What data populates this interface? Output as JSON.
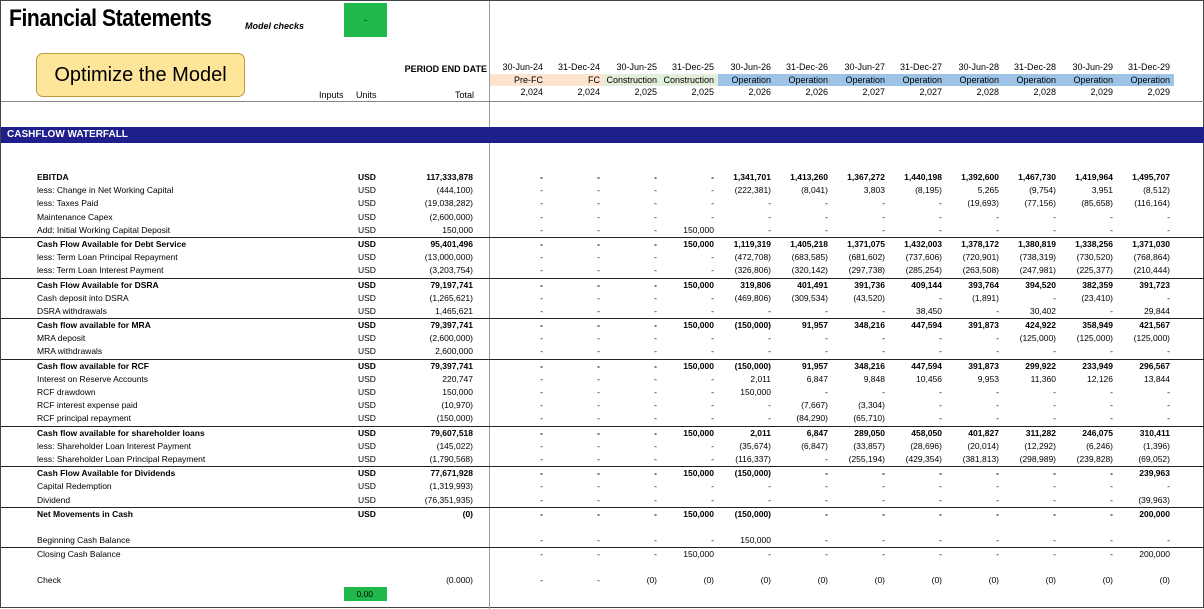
{
  "header": {
    "title": "Financial Statements",
    "model_checks_label": "Model checks",
    "model_checks_value": "-",
    "optimize_button": "Optimize the Model",
    "period_end_label": "PERIOD END DATE",
    "inputs_label": "Inputs",
    "units_label": "Units",
    "total_label": "Total"
  },
  "periods": [
    {
      "date": "30-Jun-24",
      "phase": "Pre-FC",
      "year": "2,024",
      "color": "#fde4cf"
    },
    {
      "date": "31-Dec-24",
      "phase": "FC",
      "year": "2,024",
      "color": "#fde4cf"
    },
    {
      "date": "30-Jun-25",
      "phase": "Construction",
      "year": "2,025",
      "color": "#e2efda"
    },
    {
      "date": "31-Dec-25",
      "phase": "Construction",
      "year": "2,025",
      "color": "#e2efda"
    },
    {
      "date": "30-Jun-26",
      "phase": "Operation",
      "year": "2,026",
      "color": "#9dc3e6"
    },
    {
      "date": "31-Dec-26",
      "phase": "Operation",
      "year": "2,026",
      "color": "#9dc3e6"
    },
    {
      "date": "30-Jun-27",
      "phase": "Operation",
      "year": "2,027",
      "color": "#9dc3e6"
    },
    {
      "date": "31-Dec-27",
      "phase": "Operation",
      "year": "2,027",
      "color": "#9dc3e6"
    },
    {
      "date": "30-Jun-28",
      "phase": "Operation",
      "year": "2,028",
      "color": "#9dc3e6"
    },
    {
      "date": "31-Dec-28",
      "phase": "Operation",
      "year": "2,028",
      "color": "#9dc3e6"
    },
    {
      "date": "30-Jun-29",
      "phase": "Operation",
      "year": "2,029",
      "color": "#9dc3e6"
    },
    {
      "date": "31-Dec-29",
      "phase": "Operation",
      "year": "2,029",
      "color": "#9dc3e6"
    }
  ],
  "section_title": "CASHFLOW WATERFALL",
  "rows": [
    {
      "label": "EBITDA",
      "unit": "USD",
      "total": "117,333,878",
      "bold": true,
      "vals": [
        "-",
        "-",
        "-",
        "-",
        "1,341,701",
        "1,413,260",
        "1,367,272",
        "1,440,198",
        "1,392,600",
        "1,467,730",
        "1,419,964",
        "1,495,707"
      ]
    },
    {
      "label": "less: Change in Net Working Capital",
      "unit": "USD",
      "total": "(444,100)",
      "vals": [
        "-",
        "-",
        "-",
        "-",
        "(222,381)",
        "(8,041)",
        "3,803",
        "(8,195)",
        "5,265",
        "(9,754)",
        "3,951",
        "(8,512)"
      ]
    },
    {
      "label": "less: Taxes Paid",
      "unit": "USD",
      "total": "(19,038,282)",
      "vals": [
        "-",
        "-",
        "-",
        "-",
        "-",
        "-",
        "-",
        "-",
        "(19,693)",
        "(77,156)",
        "(85,658)",
        "(116,164)"
      ]
    },
    {
      "label": "Maintenance Capex",
      "unit": "USD",
      "total": "(2,600,000)",
      "vals": [
        "-",
        "-",
        "-",
        "-",
        "-",
        "-",
        "-",
        "-",
        "-",
        "-",
        "-",
        "-"
      ]
    },
    {
      "label": "Add: Initial Working Capital Deposit",
      "unit": "USD",
      "total": "150,000",
      "vals": [
        "-",
        "-",
        "-",
        "150,000",
        "-",
        "-",
        "-",
        "-",
        "-",
        "-",
        "-",
        "-"
      ]
    },
    {
      "label": "Cash Flow Available for Debt Service",
      "unit": "USD",
      "total": "95,401,496",
      "bold": true,
      "bt": true,
      "vals": [
        "-",
        "-",
        "-",
        "150,000",
        "1,119,319",
        "1,405,218",
        "1,371,075",
        "1,432,003",
        "1,378,172",
        "1,380,819",
        "1,338,256",
        "1,371,030"
      ]
    },
    {
      "label": "less: Term Loan Principal Repayment",
      "unit": "USD",
      "total": "(13,000,000)",
      "vals": [
        "-",
        "-",
        "-",
        "-",
        "(472,708)",
        "(683,585)",
        "(681,602)",
        "(737,606)",
        "(720,901)",
        "(738,319)",
        "(730,520)",
        "(768,864)"
      ]
    },
    {
      "label": "less: Term Loan Interest Payment",
      "unit": "USD",
      "total": "(3,203,754)",
      "vals": [
        "-",
        "-",
        "-",
        "-",
        "(326,806)",
        "(320,142)",
        "(297,738)",
        "(285,254)",
        "(263,508)",
        "(247,981)",
        "(225,377)",
        "(210,444)"
      ]
    },
    {
      "label": "Cash Flow Available for DSRA",
      "unit": "USD",
      "total": "79,197,741",
      "bold": true,
      "bt": true,
      "vals": [
        "-",
        "-",
        "-",
        "150,000",
        "319,806",
        "401,491",
        "391,736",
        "409,144",
        "393,764",
        "394,520",
        "382,359",
        "391,723"
      ]
    },
    {
      "label": "Cash deposit into DSRA",
      "unit": "USD",
      "total": "(1,265,621)",
      "vals": [
        "-",
        "-",
        "-",
        "-",
        "(469,806)",
        "(309,534)",
        "(43,520)",
        "-",
        "(1,891)",
        "-",
        "(23,410)",
        "-"
      ]
    },
    {
      "label": "DSRA withdrawals",
      "unit": "USD",
      "total": "1,465,621",
      "vals": [
        "-",
        "-",
        "-",
        "-",
        "-",
        "-",
        "-",
        "38,450",
        "-",
        "30,402",
        "-",
        "29,844"
      ]
    },
    {
      "label": "Cash flow available for MRA",
      "unit": "USD",
      "total": "79,397,741",
      "bold": true,
      "bt": true,
      "vals": [
        "-",
        "-",
        "-",
        "150,000",
        "(150,000)",
        "91,957",
        "348,216",
        "447,594",
        "391,873",
        "424,922",
        "358,949",
        "421,567"
      ]
    },
    {
      "label": "MRA deposit",
      "unit": "USD",
      "total": "(2,600,000)",
      "vals": [
        "-",
        "-",
        "-",
        "-",
        "-",
        "-",
        "-",
        "-",
        "-",
        "(125,000)",
        "(125,000)",
        "(125,000)"
      ]
    },
    {
      "label": "MRA withdrawals",
      "unit": "USD",
      "total": "2,600,000",
      "vals": [
        "-",
        "-",
        "-",
        "-",
        "-",
        "-",
        "-",
        "-",
        "-",
        "-",
        "-",
        "-"
      ]
    },
    {
      "label": "Cash flow available for RCF",
      "unit": "USD",
      "total": "79,397,741",
      "bold": true,
      "bt": true,
      "vals": [
        "-",
        "-",
        "-",
        "150,000",
        "(150,000)",
        "91,957",
        "348,216",
        "447,594",
        "391,873",
        "299,922",
        "233,949",
        "296,567"
      ]
    },
    {
      "label": "Interest on Reserve Accounts",
      "unit": "USD",
      "total": "220,747",
      "vals": [
        "-",
        "-",
        "-",
        "-",
        "2,011",
        "6,847",
        "9,848",
        "10,456",
        "9,953",
        "11,360",
        "12,126",
        "13,844"
      ]
    },
    {
      "label": "RCF drawdown",
      "unit": "USD",
      "total": "150,000",
      "vals": [
        "-",
        "-",
        "-",
        "-",
        "150,000",
        "-",
        "-",
        "-",
        "-",
        "-",
        "-",
        "-"
      ]
    },
    {
      "label": "RCF interest expense paid",
      "unit": "USD",
      "total": "(10,970)",
      "vals": [
        "-",
        "-",
        "-",
        "-",
        "-",
        "(7,667)",
        "(3,304)",
        "-",
        "-",
        "-",
        "-",
        "-"
      ]
    },
    {
      "label": "RCF principal repayment",
      "unit": "USD",
      "total": "(150,000)",
      "vals": [
        "-",
        "-",
        "-",
        "-",
        "-",
        "(84,290)",
        "(65,710)",
        "-",
        "-",
        "-",
        "-",
        "-"
      ]
    },
    {
      "label": "Cash flow available for shareholder loans",
      "unit": "USD",
      "total": "79,607,518",
      "bold": true,
      "bt": true,
      "vals": [
        "-",
        "-",
        "-",
        "150,000",
        "2,011",
        "6,847",
        "289,050",
        "458,050",
        "401,827",
        "311,282",
        "246,075",
        "310,411"
      ]
    },
    {
      "label": "less: Shareholder Loan Interest Payment",
      "unit": "USD",
      "total": "(145,022)",
      "vals": [
        "-",
        "-",
        "-",
        "-",
        "(35,674)",
        "(6,847)",
        "(33,857)",
        "(28,696)",
        "(20,014)",
        "(12,292)",
        "(6,246)",
        "(1,396)"
      ]
    },
    {
      "label": "less: Shareholder Loan Principal Repayment",
      "unit": "USD",
      "total": "(1,790,568)",
      "vals": [
        "-",
        "-",
        "-",
        "-",
        "(116,337)",
        "-",
        "(255,194)",
        "(429,354)",
        "(381,813)",
        "(298,989)",
        "(239,828)",
        "(69,052)"
      ]
    },
    {
      "label": "Cash Flow Available for Dividends",
      "unit": "USD",
      "total": "77,671,928",
      "bold": true,
      "bt": true,
      "vals": [
        "-",
        "-",
        "-",
        "150,000",
        "(150,000)",
        "-",
        "-",
        "-",
        "-",
        "-",
        "-",
        "239,963"
      ]
    },
    {
      "label": "Capital Redemption",
      "unit": "USD",
      "total": "(1,319,993)",
      "vals": [
        "-",
        "-",
        "-",
        "-",
        "-",
        "-",
        "-",
        "-",
        "-",
        "-",
        "-",
        "-"
      ]
    },
    {
      "label": "Dividend",
      "unit": "USD",
      "total": "(76,351,935)",
      "vals": [
        "-",
        "-",
        "-",
        "-",
        "-",
        "-",
        "-",
        "-",
        "-",
        "-",
        "-",
        "(39,963)"
      ]
    },
    {
      "label": "Net Movements in Cash",
      "unit": "USD",
      "total": "(0)",
      "bold": true,
      "bt": true,
      "vals": [
        "-",
        "-",
        "-",
        "150,000",
        "(150,000)",
        "-",
        "-",
        "-",
        "-",
        "-",
        "-",
        "200,000"
      ]
    },
    {
      "spacer": true
    },
    {
      "label": "Beginning Cash Balance",
      "unit": "",
      "total": "",
      "vals": [
        "-",
        "-",
        "-",
        "-",
        "150,000",
        "-",
        "-",
        "-",
        "-",
        "-",
        "-",
        "-"
      ]
    },
    {
      "label": "Closing Cash Balance",
      "unit": "",
      "total": "",
      "bt": true,
      "vals": [
        "-",
        "-",
        "-",
        "150,000",
        "-",
        "-",
        "-",
        "-",
        "-",
        "-",
        "-",
        "200,000"
      ]
    },
    {
      "spacer": true
    },
    {
      "label": "Check",
      "unit": "",
      "total": "(0.000)",
      "vals": [
        "-",
        "-",
        "(0)",
        "(0)",
        "(0)",
        "(0)",
        "(0)",
        "(0)",
        "(0)",
        "(0)",
        "(0)",
        "(0)"
      ]
    }
  ],
  "check_value": "0.00"
}
